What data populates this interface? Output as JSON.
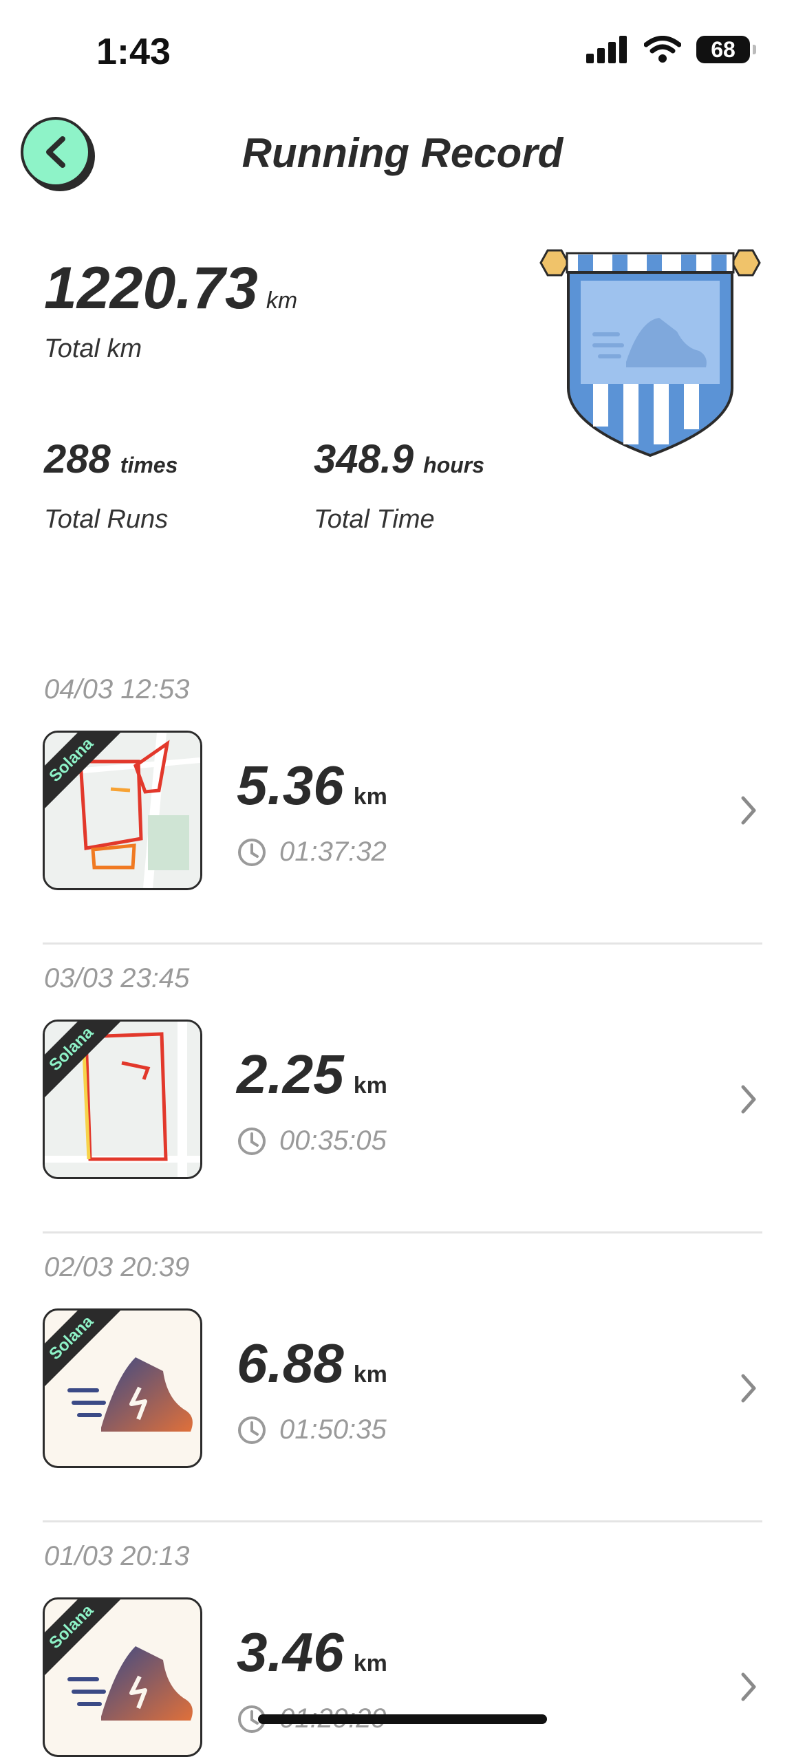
{
  "status_bar": {
    "time": "1:43",
    "battery": "68"
  },
  "header": {
    "title": "Running Record"
  },
  "summary": {
    "total_km": "1220.73",
    "total_km_unit": "km",
    "total_km_label": "Total km",
    "total_runs": "288",
    "total_runs_unit": "times",
    "total_runs_label": "Total Runs",
    "total_time": "348.9",
    "total_time_unit": "hours",
    "total_time_label": "Total Time"
  },
  "badge_label": "Solana",
  "records": [
    {
      "date": "04/03 12:53",
      "distance": "5.36",
      "unit": "km",
      "duration": "01:37:32",
      "thumb": "map"
    },
    {
      "date": "03/03 23:45",
      "distance": "2.25",
      "unit": "km",
      "duration": "00:35:05",
      "thumb": "map"
    },
    {
      "date": "02/03 20:39",
      "distance": "6.88",
      "unit": "km",
      "duration": "01:50:35",
      "thumb": "shoe"
    },
    {
      "date": "01/03 20:13",
      "distance": "3.46",
      "unit": "km",
      "duration": "01:29:29",
      "thumb": "shoe"
    }
  ],
  "colors": {
    "accent": "#8ef3c8",
    "text": "#2b2b2b",
    "muted": "#9a9a9a",
    "pennant_blue": "#5b93d6"
  }
}
